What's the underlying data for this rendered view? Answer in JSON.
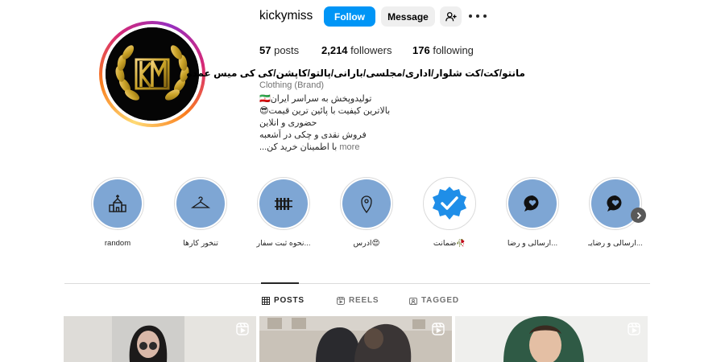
{
  "profile": {
    "username": "kickymiss",
    "follow_label": "Follow",
    "message_label": "Message",
    "add_user_icon": "add-user-icon",
    "more_icon": "more-dots-icon",
    "brand_colors": {
      "primary_button": "#0095f6",
      "avatar_gold": "#c9a227"
    }
  },
  "stats": {
    "posts_count": "57",
    "posts_label": "posts",
    "followers_count": "2,214",
    "followers_label": "followers",
    "following_count": "176",
    "following_label": "following"
  },
  "bio": {
    "name": "مانتو/کت/کت شلوار/اداری/مجلسی/بارانی/پالتو/کاپشن/کی کی میس عمده",
    "category": "Clothing (Brand)",
    "line1": "تولیدوپخش به سراسر ایران🇮🇷",
    "line2": "بالاترین کیفیت با پائین ترین قیمت😎",
    "line3": "حضوری و انلاین",
    "line4": "فروش نقدی و چکی در  اَشعبه",
    "line5": "با اطمینان خرید کن...",
    "more": "more"
  },
  "highlights": [
    {
      "label": "random",
      "icon": "church-icon"
    },
    {
      "label": "تنخور کارها",
      "icon": "hanger-icon"
    },
    {
      "label": "نحوه ثبت سفار...",
      "icon": "fence-icon"
    },
    {
      "label": "ادرس😍",
      "icon": "location-pin-icon"
    },
    {
      "label": "ضمانت🥀",
      "icon": "verified-badge-icon"
    },
    {
      "label": "ارسالی و رضا...",
      "icon": "chat-heart-icon"
    },
    {
      "label": "ارسالی و رضایـ...",
      "icon": "chat-heart-icon"
    }
  ],
  "tabs": [
    {
      "label": "POSTS",
      "icon": "grid-icon",
      "active": true
    },
    {
      "label": "REELS",
      "icon": "reels-icon",
      "active": false
    },
    {
      "label": "TAGGED",
      "icon": "tagged-icon",
      "active": false
    }
  ],
  "posts": [
    {
      "type": "reel",
      "icon": "reel-badge-icon"
    },
    {
      "type": "reel",
      "icon": "reel-badge-icon"
    },
    {
      "type": "reel",
      "icon": "reel-badge-icon"
    }
  ]
}
